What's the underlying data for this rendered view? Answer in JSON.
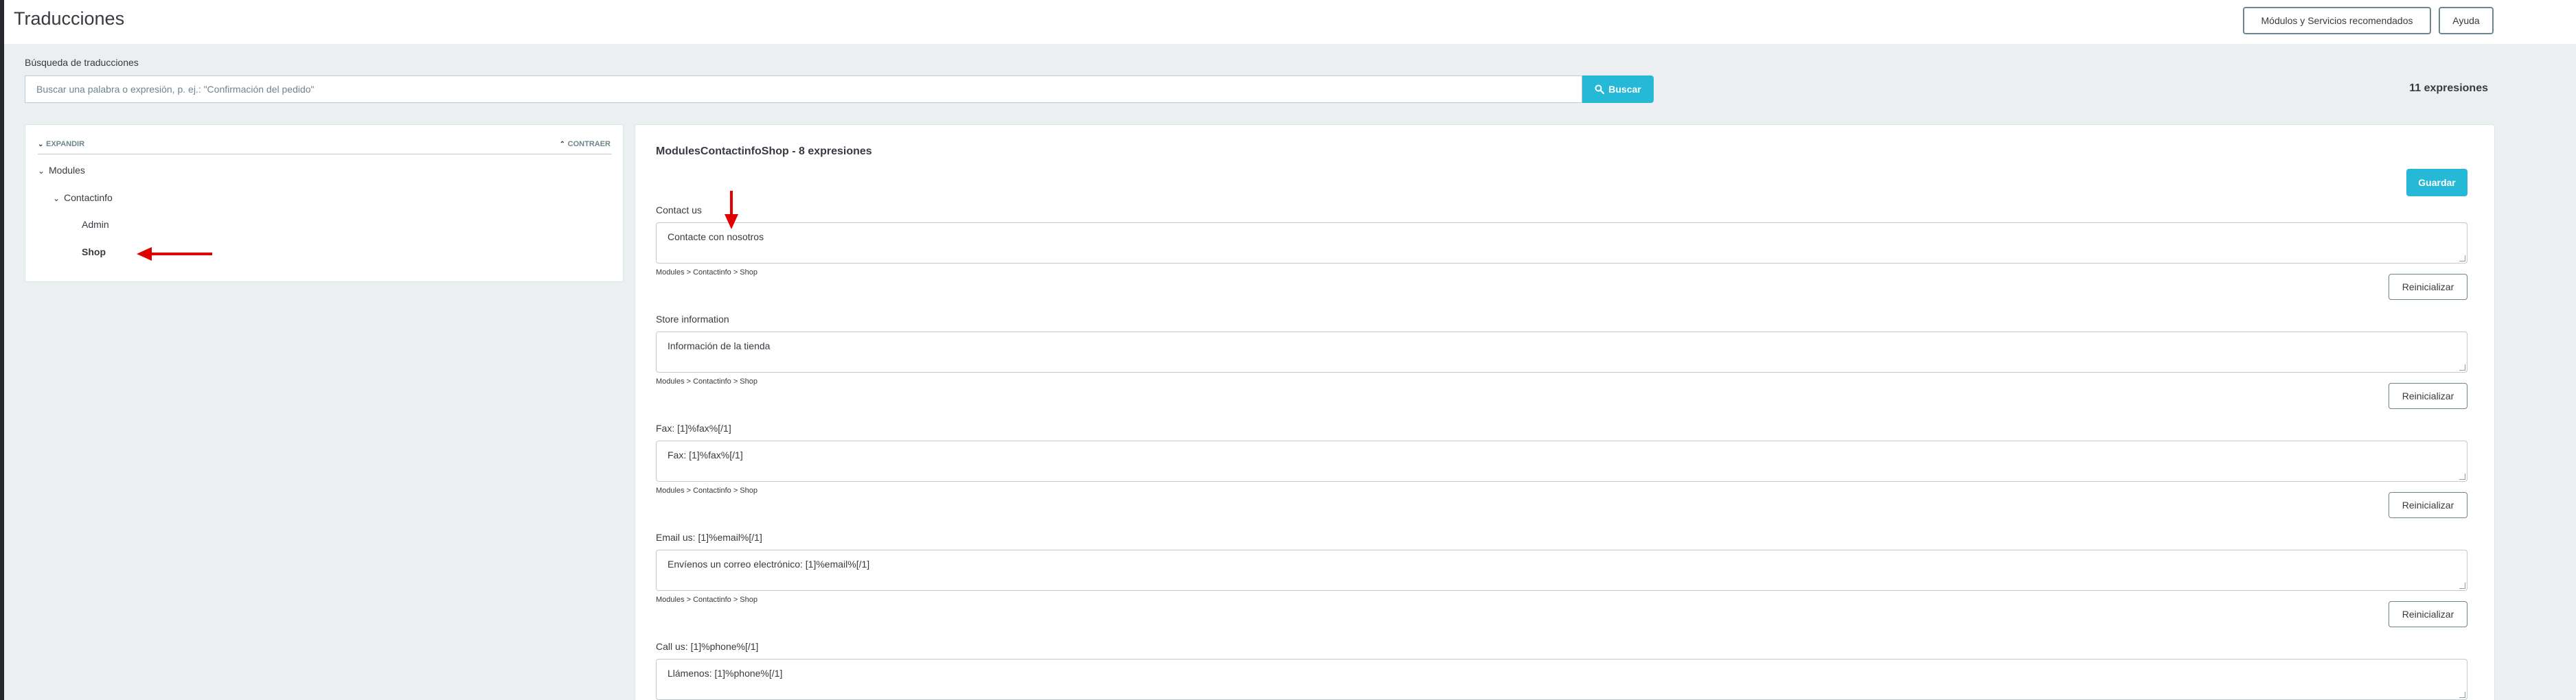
{
  "header": {
    "title": "Traducciones",
    "recommended_button": "Módulos y Servicios recomendados",
    "help_button": "Ayuda"
  },
  "search": {
    "label": "Búsqueda de traducciones",
    "placeholder": "Buscar una palabra o expresión, p. ej.: \"Confirmación del pedido\"",
    "button": "Buscar",
    "icon": "search-icon",
    "count": "11 expresiones"
  },
  "tree": {
    "expand": "EXPANDIR",
    "collapse": "CONTRAER",
    "nodes": {
      "modules": "Modules",
      "contactinfo": "Contactinfo",
      "admin": "Admin",
      "shop": "Shop"
    }
  },
  "main": {
    "title": "ModulesContactinfoShop - 8 expresiones",
    "save_button": "Guardar",
    "reset_label": "Reinicializar",
    "fields": [
      {
        "label": "Contact us",
        "value": "Contacte con nosotros",
        "path": "Modules > Contactinfo > Shop"
      },
      {
        "label": "Store information",
        "value": "Información de la tienda",
        "path": "Modules > Contactinfo > Shop"
      },
      {
        "label": "Fax: [1]%fax%[/1]",
        "value": "Fax: [1]%fax%[/1]",
        "path": "Modules > Contactinfo > Shop"
      },
      {
        "label": "Email us: [1]%email%[/1]",
        "value": "Envíenos un correo electrónico: [1]%email%[/1]",
        "path": "Modules > Contactinfo > Shop"
      },
      {
        "label": "Call us: [1]%phone%[/1]",
        "value": "Llámenos: [1]%phone%[/1]",
        "path": ""
      }
    ]
  },
  "colors": {
    "accent": "#25b9d7",
    "annotation_arrow": "#e00000",
    "background": "#eceff1"
  }
}
